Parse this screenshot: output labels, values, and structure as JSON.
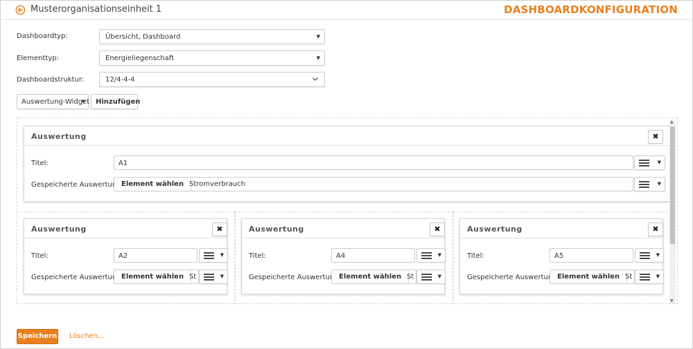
{
  "header": {
    "org_title": "Musterorganisationseinheit 1",
    "heading": "DASHBOARDKONFIGURATION",
    "accent_color": "#e8801f",
    "back_icon": "arrow-left-circle-icon"
  },
  "form": {
    "dashboard_type_label": "Dashboardtyp:",
    "dashboard_type_value": "Übersicht, Dashboard",
    "element_type_label": "Elementtyp:",
    "element_type_value": "Energieliegenschaft",
    "structure_label": "Dashboardstruktur:",
    "structure_value": "12/4-4-4"
  },
  "toolbar": {
    "widget_select": "Auswertung-Widget",
    "add_button": "Hinzufügen"
  },
  "widgets": {
    "full": {
      "title": "Auswertung",
      "titel_label": "Titel:",
      "titel_value": "A1",
      "saved_label": "Gespeicherte Auswertung:",
      "element_button": "Element wählen",
      "saved_value": "Stromverbrauch"
    },
    "col1": {
      "title": "Auswertung",
      "titel_label": "Titel:",
      "titel_value": "A2",
      "saved_label": "Gespeicherte Auswertung:",
      "element_button": "Element wählen",
      "saved_value": "St"
    },
    "col2": {
      "title": "Auswertung",
      "titel_label": "Titel:",
      "titel_value": "A4",
      "saved_label": "Gespeicherte Auswertung:",
      "element_button": "Element wählen",
      "saved_value": "St"
    },
    "col3": {
      "title": "Auswertung",
      "titel_label": "Titel:",
      "titel_value": "A5",
      "saved_label": "Gespeicherte Auswertung:",
      "element_button": "Element wählen",
      "saved_value": "St"
    },
    "close_symbol": "✖"
  },
  "footer": {
    "save_button": "Speichern",
    "delete_link": "Löschen..."
  }
}
